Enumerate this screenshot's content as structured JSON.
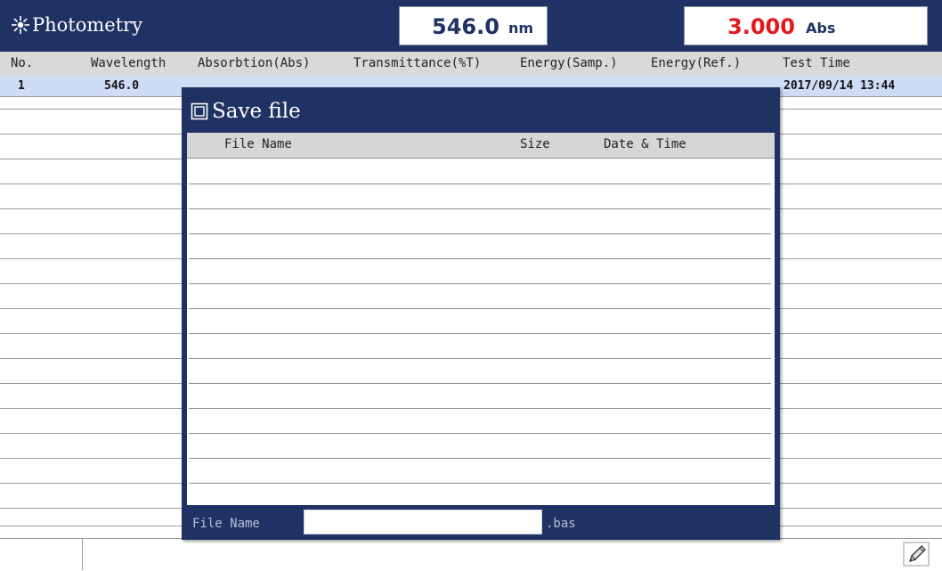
{
  "header": {
    "title": "Photometry",
    "title_icon": "sun-icon",
    "wavelength_value": "546.0",
    "wavelength_unit": "nm",
    "abs_value": "3.000",
    "abs_unit": "Abs"
  },
  "table": {
    "columns": [
      "No.",
      "Wavelength",
      "Absorbtion(Abs)",
      "Transmittance(%T)",
      "Energy(Samp.)",
      "Energy(Ref.)",
      "Test Time"
    ],
    "rows": [
      {
        "no": "1",
        "wavelength": "546.0",
        "test_time": "2017/09/14 13:44"
      }
    ]
  },
  "dialog": {
    "title": "Save file",
    "title_icon": "chip-icon",
    "columns": [
      "File Name",
      "Size",
      "Date & Time"
    ],
    "filename_label": "File Name",
    "filename_value": "",
    "extension": ".bas"
  },
  "status_bar": {
    "edit_icon": "pencil-icon"
  },
  "colors": {
    "header_bg": "#1f3263",
    "abs_value": "#e0191c",
    "selected_row": "#cfdcf6"
  }
}
